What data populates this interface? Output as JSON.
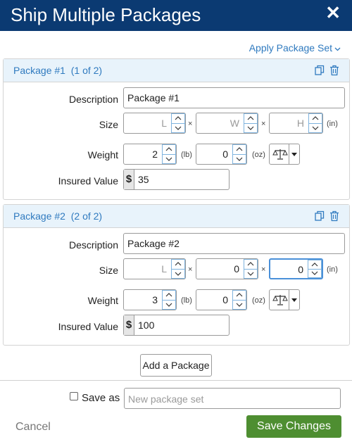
{
  "header": {
    "title": "Ship Multiple Packages",
    "close": "✕"
  },
  "apply_set": {
    "label": "Apply Package Set"
  },
  "labels": {
    "description": "Description",
    "size": "Size",
    "weight": "Weight",
    "insured": "Insured Value",
    "times": "×",
    "in": "(in)",
    "lb": "(lb)",
    "oz": "(oz)",
    "dollar": "$"
  },
  "packages": [
    {
      "title": "Package #1",
      "count": "(1 of 2)",
      "description": "Package #1",
      "size": {
        "l": "L",
        "w": "W",
        "h": "H"
      },
      "weight_lb": "2",
      "weight_oz": "0",
      "insured": "35"
    },
    {
      "title": "Package #2",
      "count": "(2 of 2)",
      "description": "Package #2",
      "size": {
        "l": "L",
        "w": "0",
        "h": "0"
      },
      "weight_lb": "3",
      "weight_oz": "0",
      "insured": "100"
    }
  ],
  "add_package": "Add a Package",
  "save_as": {
    "label": "Save as",
    "placeholder": "New package set"
  },
  "footer": {
    "cancel": "Cancel",
    "save": "Save Changes"
  },
  "colors": {
    "header_bg": "#0b3a72",
    "link": "#2f7abf",
    "save_bg": "#4e8e31"
  }
}
